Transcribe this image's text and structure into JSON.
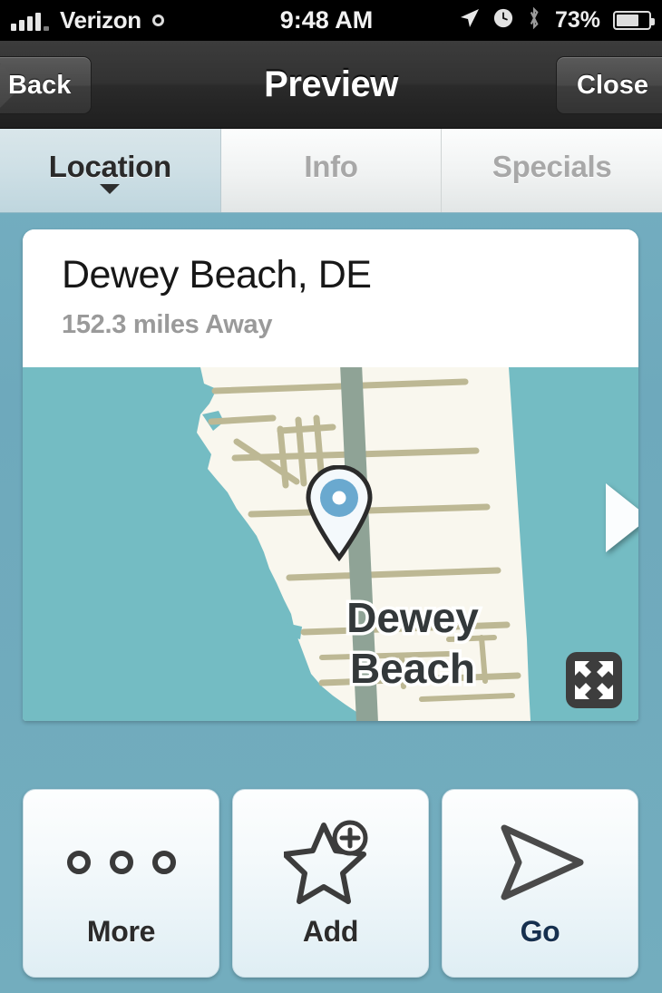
{
  "status_bar": {
    "carrier": "Verizon",
    "time": "9:48 AM",
    "battery_percent": "73%",
    "icons": [
      "signal-bars-icon",
      "network-circle-icon",
      "location-arrow-icon",
      "alarm-clock-icon",
      "bluetooth-icon",
      "battery-icon"
    ]
  },
  "nav_bar": {
    "back_label": "Back",
    "title": "Preview",
    "close_label": "Close"
  },
  "tabs": [
    {
      "label": "Location",
      "active": true
    },
    {
      "label": "Info",
      "active": false
    },
    {
      "label": "Specials",
      "active": false
    }
  ],
  "card": {
    "place_name": "Dewey Beach, DE",
    "distance": "152.3 miles Away",
    "map": {
      "label": "Dewey\nBeach",
      "label_line1": "Dewey",
      "label_line2": "Beach",
      "water_color": "#74bcc3",
      "land_color": "#f9f7ee",
      "road_color": "#bdb894",
      "highway_color": "#8fa396",
      "pin": {
        "outline_color": "#2b2b2b",
        "ring_color": "#6aa9cf",
        "center_color": "#ffffff"
      },
      "next_arrow_icon": "next-arrow-icon",
      "fullscreen_icon": "fullscreen-expand-icon"
    }
  },
  "actions": [
    {
      "label": "More",
      "icon": "three-dots-icon",
      "accent": false
    },
    {
      "label": "Add",
      "icon": "star-plus-icon",
      "accent": false
    },
    {
      "label": "Go",
      "icon": "navigate-arrow-icon",
      "accent": true
    }
  ],
  "colors": {
    "background_blue": "#73adbe",
    "accent_navy": "#16304f",
    "map_water": "#74bcc3"
  }
}
